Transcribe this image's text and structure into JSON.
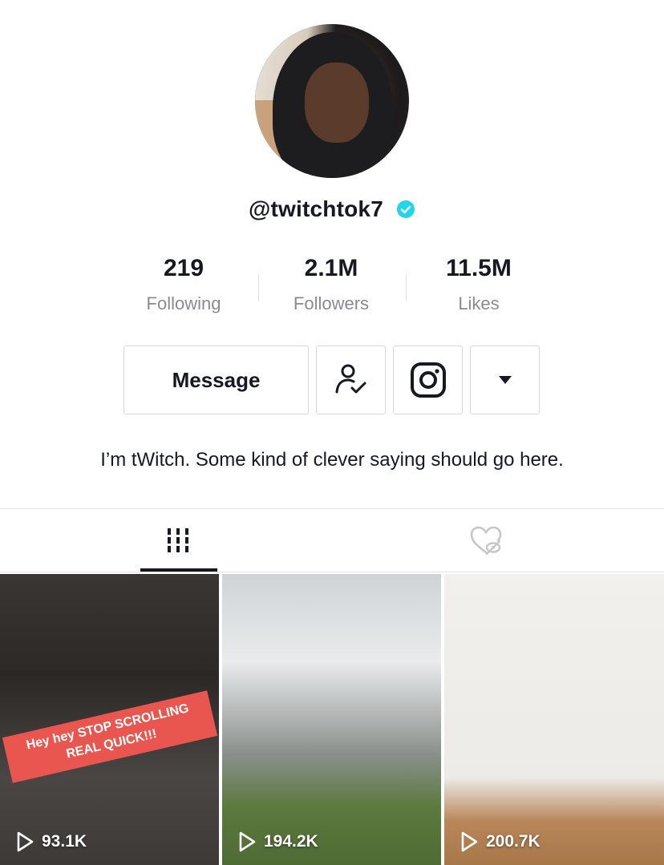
{
  "profile": {
    "username": "@twitchtok7",
    "verified": true,
    "bio": "I’m tWitch. Some kind of clever saying should go here."
  },
  "stats": [
    {
      "value": "219",
      "label": "Following"
    },
    {
      "value": "2.1M",
      "label": "Followers"
    },
    {
      "value": "11.5M",
      "label": "Likes"
    }
  ],
  "actions": {
    "message_label": "Message",
    "follow_icon": "user-check-icon",
    "instagram_icon": "instagram-icon",
    "more_icon": "caret-down-icon"
  },
  "tabs": [
    {
      "icon": "grid-icon",
      "active": true
    },
    {
      "icon": "liked-hidden-icon",
      "active": false
    }
  ],
  "videos": [
    {
      "views": "93.1K",
      "overlay_text_line1": "Hey hey STOP SCROLLING",
      "overlay_text_line2": "REAL QUICK!!!"
    },
    {
      "views": "194.2K"
    },
    {
      "views": "200.7K"
    }
  ],
  "colors": {
    "verified_badge": "#20d5ec",
    "text_primary": "#161823",
    "text_secondary": "#8a8b91",
    "sticker": "#e8564f"
  }
}
